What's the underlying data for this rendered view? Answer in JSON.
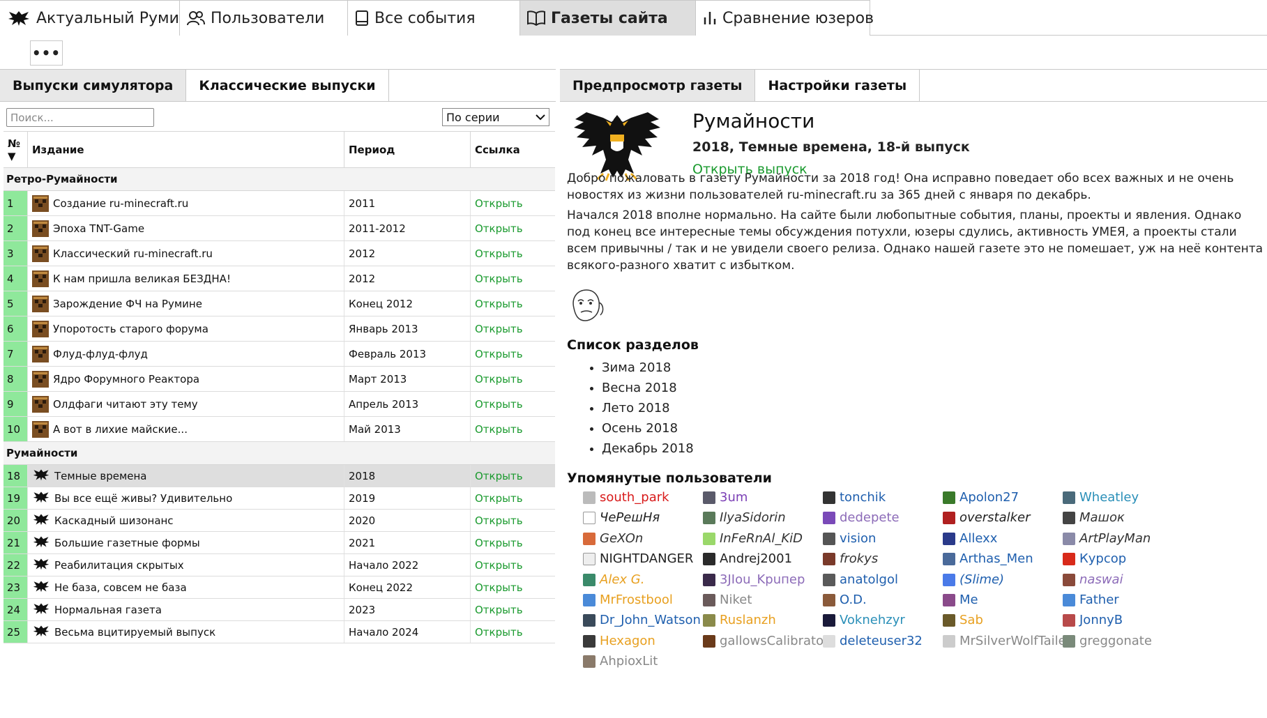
{
  "top_tabs": [
    {
      "label": "Актуальный Румине",
      "icon": "eagle-icon",
      "active": false
    },
    {
      "label": "Пользователи",
      "icon": "users-icon",
      "active": false
    },
    {
      "label": "Все события",
      "icon": "book-icon",
      "active": false
    },
    {
      "label": "Газеты сайта",
      "icon": "open-book-icon",
      "active": true
    },
    {
      "label": "Сравнение юзеров",
      "icon": "bar-chart-icon",
      "active": false
    }
  ],
  "more_button": "•••",
  "left": {
    "tabs": [
      {
        "label": "Выпуски симулятора",
        "active": true
      },
      {
        "label": "Классические выпуски",
        "active": false
      }
    ],
    "search_placeholder": "Поиск...",
    "sort_value": "По серии",
    "columns": [
      "№ ▼",
      "Издание",
      "Период",
      "Ссылка"
    ],
    "groups": [
      {
        "name": "Ретро-Румайности",
        "icon": "creeper-icon",
        "rows": [
          {
            "num": "1",
            "title": "Создание ru-minecraft.ru",
            "period": "2011",
            "link": "Открыть"
          },
          {
            "num": "2",
            "title": "Эпоха TNT-Game",
            "period": "2011-2012",
            "link": "Открыть"
          },
          {
            "num": "3",
            "title": "Классический ru-minecraft.ru",
            "period": "2012",
            "link": "Открыть"
          },
          {
            "num": "4",
            "title": "К нам пришла великая БЕЗДНА!",
            "period": "2012",
            "link": "Открыть"
          },
          {
            "num": "5",
            "title": "Зарождение ФЧ на Румине",
            "period": "Конец 2012",
            "link": "Открыть"
          },
          {
            "num": "6",
            "title": "Упоротость старого форума",
            "period": "Январь 2013",
            "link": "Открыть"
          },
          {
            "num": "7",
            "title": "Флуд-флуд-флуд",
            "period": "Февраль 2013",
            "link": "Открыть"
          },
          {
            "num": "8",
            "title": "Ядро Форумного Реактора",
            "period": "Март 2013",
            "link": "Открыть"
          },
          {
            "num": "9",
            "title": "Олдфаги читают эту тему",
            "period": "Апрель 2013",
            "link": "Открыть"
          },
          {
            "num": "10",
            "title": "А вот в лихие майские...",
            "period": "Май 2013",
            "link": "Открыть"
          }
        ]
      },
      {
        "name": "Румайности",
        "icon": "eagle-icon",
        "rows": [
          {
            "num": "18",
            "title": "Темные времена",
            "period": "2018",
            "link": "Открыть",
            "selected": true
          },
          {
            "num": "19",
            "title": "Вы все ещё живы? Удивительно",
            "period": "2019",
            "link": "Открыть"
          },
          {
            "num": "20",
            "title": "Каскадный шизонанс",
            "period": "2020",
            "link": "Открыть"
          },
          {
            "num": "21",
            "title": "Большие газетные формы",
            "period": "2021",
            "link": "Открыть"
          },
          {
            "num": "22",
            "title": "Реабилитация скрытых",
            "period": "Начало 2022",
            "link": "Открыть"
          },
          {
            "num": "23",
            "title": "Не база, совсем не база",
            "period": "Конец 2022",
            "link": "Открыть"
          },
          {
            "num": "24",
            "title": "Нормальная газета",
            "period": "2023",
            "link": "Открыть"
          },
          {
            "num": "25",
            "title": "Весьма вцитируемый выпуск",
            "period": "Начало 2024",
            "link": "Открыть"
          }
        ]
      }
    ]
  },
  "right": {
    "tabs": [
      {
        "label": "Предпросмотр газеты",
        "active": true
      },
      {
        "label": "Настройки газеты",
        "active": false
      }
    ],
    "title": "Румайности",
    "subtitle": "2018, Темные времена, 18-й выпуск",
    "open_link": "Открыть выпуск",
    "paragraph1": "Добро пожаловать в газету Румайности за 2018 год! Она исправно поведает обо всех важных и не очень новостях из жизни пользователей ru-minecraft.ru за 365 дней с января по декабрь.",
    "paragraph2": "Начался 2018 вполне нормально. На сайте были любопытные события, планы, проекты и явления. Однако под конец все интересные темы обсуждения потухли, юзеры сдулись, активность УМЕЯ, а проекты стали всем привычны / так и не увидели своего релиза. Однако нашей газете это не помешает, уж на неё контента всякого-разного хватит с избытком.",
    "sections_heading": "Список разделов",
    "sections": [
      "Зима 2018",
      "Весна 2018",
      "Лето 2018",
      "Осень 2018",
      "Декабрь 2018"
    ],
    "users_heading": "Упомянутые пользователи",
    "users": [
      {
        "name": "south_park",
        "color": "#d81b1b",
        "italic": false,
        "avatar": "#bbbbbb"
      },
      {
        "name": "3um",
        "color": "#7b3fb5",
        "italic": false,
        "avatar": "#5a5a6a"
      },
      {
        "name": "tonchik",
        "color": "#1f5fae",
        "italic": false,
        "avatar": "#333333"
      },
      {
        "name": "Apolon27",
        "color": "#1f5fae",
        "italic": false,
        "avatar": "#3a7a2a"
      },
      {
        "name": "Wheatley",
        "color": "#2a8fb8",
        "italic": false,
        "avatar": "#4a6a7a"
      },
      {
        "name": "ЧеРешНя",
        "color": "#222222",
        "italic": true,
        "avatar": "#ffffff"
      },
      {
        "name": "IlyaSidorin",
        "color": "#333333",
        "italic": true,
        "avatar": "#5a7a5a"
      },
      {
        "name": "dedepete",
        "color": "#8c6bb8",
        "italic": false,
        "avatar": "#7a4ab8"
      },
      {
        "name": "overstalker",
        "color": "#222222",
        "italic": true,
        "avatar": "#b02020"
      },
      {
        "name": "Машок",
        "color": "#333333",
        "italic": true,
        "avatar": "#444444"
      },
      {
        "name": "GeXOn",
        "color": "#333333",
        "italic": true,
        "avatar": "#d86a3a"
      },
      {
        "name": "InFeRnAl_KiD",
        "color": "#333333",
        "italic": true,
        "avatar": "#9ad86a"
      },
      {
        "name": "vision",
        "color": "#1f5fae",
        "italic": false,
        "avatar": "#555555"
      },
      {
        "name": "Allexx",
        "color": "#1f5fae",
        "italic": false,
        "avatar": "#2a3a8a"
      },
      {
        "name": "ArtPlayMan",
        "color": "#333333",
        "italic": true,
        "avatar": "#8a8aa8"
      },
      {
        "name": "NIGHTDANGER",
        "color": "#222222",
        "italic": false,
        "avatar": "#eeeeee"
      },
      {
        "name": "Andrej2001",
        "color": "#222222",
        "italic": false,
        "avatar": "#2a2a2a"
      },
      {
        "name": "frokys",
        "color": "#333333",
        "italic": true,
        "avatar": "#7a3a2a"
      },
      {
        "name": "Arthas_Men",
        "color": "#1f5fae",
        "italic": false,
        "avatar": "#4a6a9a"
      },
      {
        "name": "Курсор",
        "color": "#1f5fae",
        "italic": false,
        "avatar": "#d82a1a"
      },
      {
        "name": "Alex G.",
        "color": "#e8a020",
        "italic": true,
        "avatar": "#3a8a6a"
      },
      {
        "name": "3JIou_Kpuпep",
        "color": "#8c6bb8",
        "italic": false,
        "avatar": "#3a2a4a"
      },
      {
        "name": "anatolgol",
        "color": "#1f5fae",
        "italic": false,
        "avatar": "#5a5a5a"
      },
      {
        "name": "(Slime)",
        "color": "#1f5fae",
        "italic": true,
        "avatar": "#4a7ae8"
      },
      {
        "name": "naswai",
        "color": "#8c6bb8",
        "italic": true,
        "avatar": "#8a4a3a"
      },
      {
        "name": "MrFrostbool",
        "color": "#e8a020",
        "italic": false,
        "avatar": "#4a8ad8"
      },
      {
        "name": "Niket",
        "color": "#888888",
        "italic": false,
        "avatar": "#6a5a5a"
      },
      {
        "name": "O.D.",
        "color": "#1f5fae",
        "italic": false,
        "avatar": "#8a5a3a"
      },
      {
        "name": "Me",
        "color": "#1f5fae",
        "italic": false,
        "avatar": "#8a4a8a"
      },
      {
        "name": "Father",
        "color": "#1f5fae",
        "italic": false,
        "avatar": "#4a8ad8"
      },
      {
        "name": "Dr_John_Watson",
        "color": "#1f5fae",
        "italic": false,
        "avatar": "#3a4a5a"
      },
      {
        "name": "Ruslanzh",
        "color": "#e8a020",
        "italic": false,
        "avatar": "#8a8a4a"
      },
      {
        "name": "Voknehzyr",
        "color": "#2a8fb8",
        "italic": false,
        "avatar": "#1a1a3a"
      },
      {
        "name": "Sab",
        "color": "#e8a020",
        "italic": false,
        "avatar": "#6a5a2a"
      },
      {
        "name": "JonnyB",
        "color": "#1f5fae",
        "italic": false,
        "avatar": "#b84a4a"
      },
      {
        "name": "Hexagon",
        "color": "#e8a020",
        "italic": false,
        "avatar": "#3a3a3a"
      },
      {
        "name": "gallowsCalibrator",
        "color": "#888888",
        "italic": false,
        "avatar": "#6a3a1a"
      },
      {
        "name": "deleteuser32",
        "color": "#1f5fae",
        "italic": false,
        "avatar": "#dddddd"
      },
      {
        "name": "MrSilverWolfTailer",
        "color": "#888888",
        "italic": false,
        "avatar": "#cccccc"
      },
      {
        "name": "greggonate",
        "color": "#888888",
        "italic": false,
        "avatar": "#7a8a7a"
      },
      {
        "name": "AhpioxLit",
        "color": "#888888",
        "italic": false,
        "avatar": "#8a7a6a"
      }
    ]
  }
}
